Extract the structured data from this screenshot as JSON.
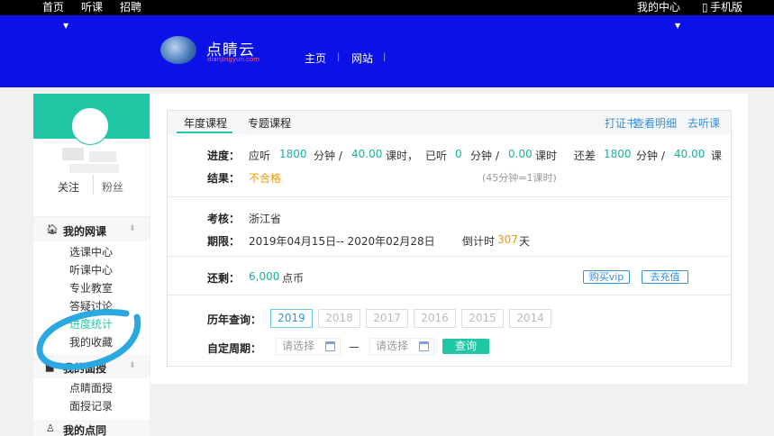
{
  "topbar": {
    "home": "首页",
    "listen": "听课",
    "recruit": "招聘",
    "my_center": "我的中心",
    "mobile": "手机版"
  },
  "banner": {
    "logo_text": "点睛云",
    "logo_sub": "dianjingyun.com",
    "nav_home": "主页",
    "nav_site": "网站"
  },
  "sidebar": {
    "follow": "关注",
    "fans": "粉丝",
    "sections": [
      {
        "title": "我的网课",
        "items": [
          "选课中心",
          "听课中心",
          "专业教室",
          "答疑讨论",
          "进度统计",
          "我的收藏"
        ]
      },
      {
        "title": "我的面授",
        "items": [
          "点睛面授",
          "面授记录"
        ]
      },
      {
        "title": "我的点同",
        "items": []
      }
    ]
  },
  "tabs": {
    "annual": "年度课程",
    "special": "专题课程",
    "print_cert": "打证书",
    "view_detail": "查看明细",
    "go_listen": "去听课"
  },
  "progress": {
    "label": "进度：",
    "should_listen": "应听",
    "should_minutes": "1800",
    "minutes_unit": "分钟 /",
    "should_hours": "40.00",
    "hours_unit": "课时，",
    "listened": "已听",
    "listened_minutes": "0",
    "listened_hours": "0.00",
    "hours_unit2": "课时",
    "remaining": "还差",
    "remaining_minutes": "1800",
    "remaining_hours": "40.00",
    "hours_unit3": "课"
  },
  "result": {
    "label": "结果：",
    "value": "不合格",
    "note": "(45分钟=1课时)"
  },
  "assessment": {
    "label": "考核：",
    "value": "浙江省",
    "period_label": "期限：",
    "period_value": "2019年04月15日-- 2020年02月28日",
    "countdown_prefix": "倒计时",
    "countdown_days": "307",
    "countdown_unit": "天"
  },
  "balance": {
    "label": "还剩：",
    "value": "6,000",
    "unit": "点币",
    "buy_vip": "购买vip",
    "recharge": "去充值"
  },
  "history": {
    "label": "历年查询：",
    "years": [
      "2019",
      "2018",
      "2017",
      "2016",
      "2015",
      "2014"
    ],
    "selected": "2019"
  },
  "custom_period": {
    "label": "自定周期：",
    "start_placeholder": "请选择",
    "dash": "—",
    "end_placeholder": "请选择",
    "query": "查询"
  },
  "colors": {
    "banner": "#0a12e8",
    "teal": "#1fc7a5",
    "orange": "#f39800",
    "link": "#3a8fd8"
  }
}
